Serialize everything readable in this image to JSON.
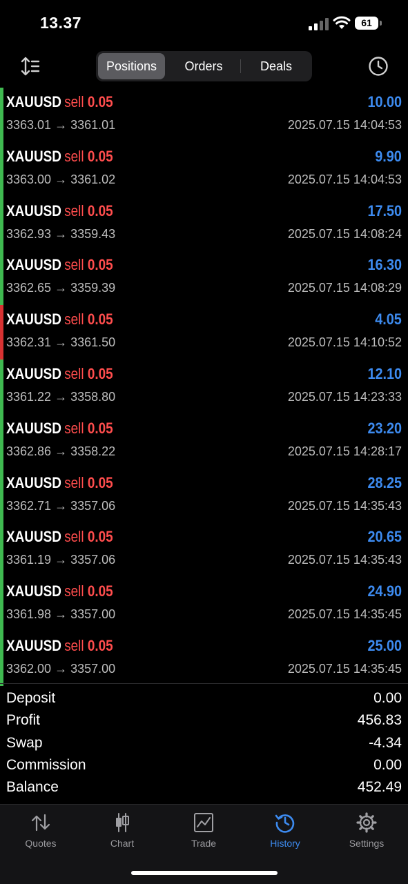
{
  "status_bar": {
    "time": "13.37",
    "battery": "61"
  },
  "tabs": [
    {
      "label": "Positions",
      "active": true
    },
    {
      "label": "Orders",
      "active": false
    },
    {
      "label": "Deals",
      "active": false
    }
  ],
  "deals": [
    {
      "symbol": "XAUUSD",
      "type": "sell",
      "volume": "0.05",
      "profit": "10.00",
      "prices": "3363.01 → 3361.01",
      "time": "2025.07.15 14:04:53",
      "bar": "green"
    },
    {
      "symbol": "XAUUSD",
      "type": "sell",
      "volume": "0.05",
      "profit": "9.90",
      "prices": "3363.00 → 3361.02",
      "time": "2025.07.15 14:04:53",
      "bar": "green"
    },
    {
      "symbol": "XAUUSD",
      "type": "sell",
      "volume": "0.05",
      "profit": "17.50",
      "prices": "3362.93 → 3359.43",
      "time": "2025.07.15 14:08:24",
      "bar": "green"
    },
    {
      "symbol": "XAUUSD",
      "type": "sell",
      "volume": "0.05",
      "profit": "16.30",
      "prices": "3362.65 → 3359.39",
      "time": "2025.07.15 14:08:29",
      "bar": "green"
    },
    {
      "symbol": "XAUUSD",
      "type": "sell",
      "volume": "0.05",
      "profit": "4.05",
      "prices": "3362.31 → 3361.50",
      "time": "2025.07.15 14:10:52",
      "bar": "red"
    },
    {
      "symbol": "XAUUSD",
      "type": "sell",
      "volume": "0.05",
      "profit": "12.10",
      "prices": "3361.22 → 3358.80",
      "time": "2025.07.15 14:23:33",
      "bar": "green"
    },
    {
      "symbol": "XAUUSD",
      "type": "sell",
      "volume": "0.05",
      "profit": "23.20",
      "prices": "3362.86 → 3358.22",
      "time": "2025.07.15 14:28:17",
      "bar": "green"
    },
    {
      "symbol": "XAUUSD",
      "type": "sell",
      "volume": "0.05",
      "profit": "28.25",
      "prices": "3362.71 → 3357.06",
      "time": "2025.07.15 14:35:43",
      "bar": "green"
    },
    {
      "symbol": "XAUUSD",
      "type": "sell",
      "volume": "0.05",
      "profit": "20.65",
      "prices": "3361.19 → 3357.06",
      "time": "2025.07.15 14:35:43",
      "bar": "green"
    },
    {
      "symbol": "XAUUSD",
      "type": "sell",
      "volume": "0.05",
      "profit": "24.90",
      "prices": "3361.98 → 3357.00",
      "time": "2025.07.15 14:35:45",
      "bar": "green"
    },
    {
      "symbol": "XAUUSD",
      "type": "sell",
      "volume": "0.05",
      "profit": "25.00",
      "prices": "3362.00 → 3357.00",
      "time": "2025.07.15 14:35:45",
      "bar": "green"
    }
  ],
  "summary": [
    {
      "label": "Deposit",
      "value": "0.00"
    },
    {
      "label": "Profit",
      "value": "456.83"
    },
    {
      "label": "Swap",
      "value": "-4.34"
    },
    {
      "label": "Commission",
      "value": "0.00"
    },
    {
      "label": "Balance",
      "value": "452.49"
    }
  ],
  "nav": [
    {
      "label": "Quotes",
      "icon": "quotes-arrows-icon",
      "active": false
    },
    {
      "label": "Chart",
      "icon": "candlestick-icon",
      "active": false
    },
    {
      "label": "Trade",
      "icon": "trade-chart-icon",
      "active": false
    },
    {
      "label": "History",
      "icon": "history-clock-icon",
      "active": true
    },
    {
      "label": "Settings",
      "icon": "gear-icon",
      "active": false
    }
  ],
  "colors": {
    "profit": "#3d8bf0",
    "sell": "#ff4d4d",
    "bar_green": "#3fb950",
    "bar_red": "#d83232",
    "active_nav": "#3d8bf0"
  }
}
